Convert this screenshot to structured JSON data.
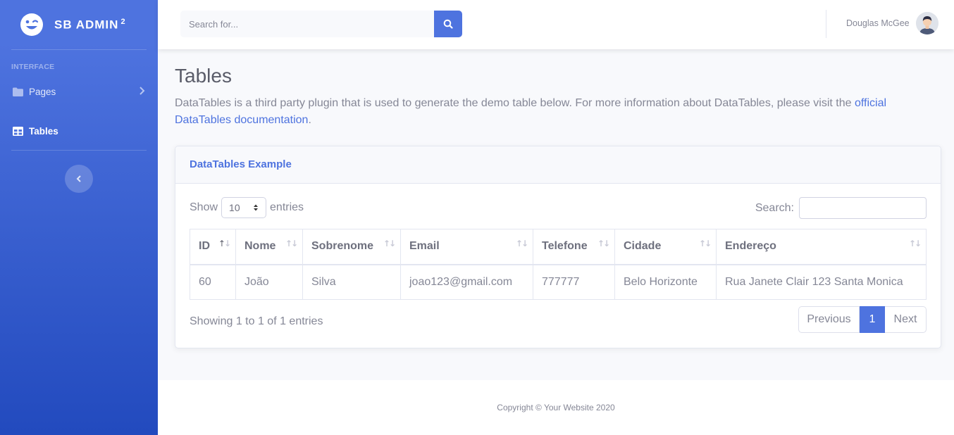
{
  "sidebar": {
    "brand": {
      "name": "SB ADMIN",
      "superscript": "2"
    },
    "heading": "INTERFACE",
    "items": [
      {
        "label": "Pages",
        "icon": "folder-icon",
        "has_submenu": true,
        "active": false
      },
      {
        "label": "Tables",
        "icon": "table-icon",
        "has_submenu": false,
        "active": true
      }
    ],
    "toggle_icon": "chevron-left-icon"
  },
  "topbar": {
    "search": {
      "placeholder": "Search for...",
      "value": ""
    },
    "user_name": "Douglas McGee"
  },
  "main": {
    "title": "Tables",
    "description": "DataTables is a third party plugin that is used to generate the demo table below. For more information about DataTables, please visit the ",
    "link_text": "official DataTables documentation",
    "description_end": ".",
    "card": {
      "title": "DataTables Example",
      "show_label": "Show",
      "entries_label": "entries",
      "page_length": "10",
      "search_label": "Search:",
      "columns": [
        "ID",
        "Nome",
        "Sobrenome",
        "Email",
        "Telefone",
        "Cidade",
        "Endereço"
      ],
      "rows": [
        [
          "60",
          "João",
          "Silva",
          "joao123@gmail.com",
          "777777",
          "Belo Horizonte",
          "Rua Janete Clair 123 Santa Monica"
        ]
      ],
      "info": "Showing 1 to 1 of 1 entries",
      "pagination": {
        "previous": "Previous",
        "current": "1",
        "next": "Next"
      }
    }
  },
  "footer": {
    "copyright": "Copyright © Your Website 2020"
  },
  "colors": {
    "primary": "#4e73df",
    "primary_dark": "#224abe",
    "text": "#858796",
    "heading": "#5a5c69"
  }
}
